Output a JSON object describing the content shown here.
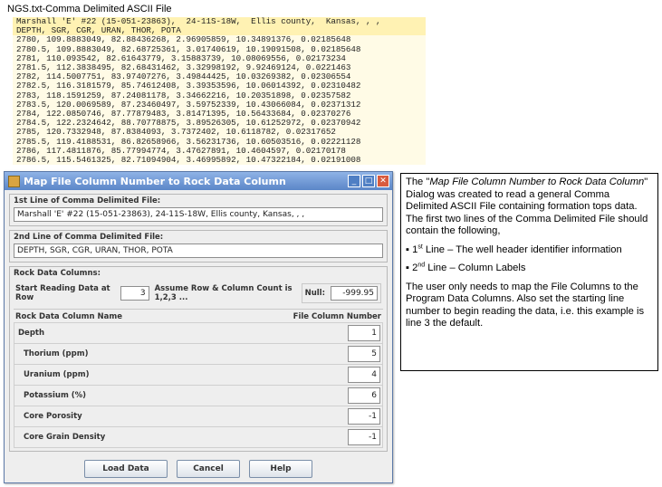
{
  "file": {
    "title": "NGS.txt-Comma Delimited ASCII File",
    "lines": [
      "Marshall 'E' #22 (15-051-23863),  24-11S-18W,  Ellis county,  Kansas, , ,",
      "DEPTH, SGR, CGR, URAN, THOR, POTA",
      "2780, 109.8883049, 82.88436268, 2.96905859, 10.34891376, 0.02185648",
      "2780.5, 109.8883049, 82.68725361, 3.01740619, 10.19091508, 0.02185648",
      "2781, 110.093542, 82.61643779, 3.15883739, 10.08069556, 0.02173234",
      "2781.5, 112.3838495, 82.68431462, 3.32998192, 9.92469124, 0.0221463",
      "2782, 114.5007751, 83.97407276, 3.49844425, 10.03269382, 0.02306554",
      "2782.5, 116.3181579, 85.74612408, 3.39353596, 10.06014392, 0.02310482",
      "2783, 118.1591259, 87.24081178, 3.34662216, 10.20351898, 0.02357582",
      "2783.5, 120.0069589, 87.23460497, 3.59752339, 10.43066084, 0.02371312",
      "2784, 122.0850746, 87.77879483, 3.81471395, 10.56433684, 0.02370276",
      "2784.5, 122.2324642, 88.70778875, 3.89526305, 10.61252972, 0.02370942",
      "2785, 120.7332948, 87.8384093, 3.7372402, 10.6118782, 0.02317652",
      "2785.5, 119.4188531, 86.82658966, 3.56231736, 10.60503516, 0.02221128",
      "2786, 117.4811876, 85.77994774, 3.47627891, 10.4604597, 0.02170178",
      "2786.5, 115.5461325, 82.71094904, 3.46995892, 10.47322184, 0.02191008"
    ]
  },
  "dialog": {
    "title": "Map File Column Number to Rock Data Column",
    "line1_label": "1st Line of Comma Delimited File:",
    "line1_value": "Marshall 'E' #22 (15-051-23863),  24-11S-18W,  Ellis county,  Kansas, , ,",
    "line2_label": "2nd Line of Comma Delimited File:",
    "line2_value": "DEPTH, SGR, CGR, URAN, THOR, POTA",
    "rock_label": "Rock Data Columns:",
    "start_label": "Start Reading Data at Row",
    "start_value": "3",
    "assume_label": "Assume Row & Column Count is 1,2,3 ...",
    "null_label": "Null:",
    "null_value": "-999.95",
    "col_name_header": "Rock Data Column Name",
    "file_col_header": "File Column Number",
    "rows": [
      {
        "label": "Depth",
        "value": "1"
      },
      {
        "label": "Thorium (ppm)",
        "value": "5"
      },
      {
        "label": "Uranium (ppm)",
        "value": "4"
      },
      {
        "label": "Potassium (%)",
        "value": "6"
      },
      {
        "label": "Core Porosity",
        "value": "-1"
      },
      {
        "label": "Core Grain Density",
        "value": "-1"
      }
    ],
    "buttons": {
      "load": "Load Data",
      "cancel": "Cancel",
      "help": "Help"
    },
    "window_controls": {
      "minimize": "_",
      "maximize": "□",
      "close": "✕"
    }
  },
  "description": {
    "p1_a": "The \"",
    "p1_italic": "Map File Column Number to Rock Data Column",
    "p1_b": "\" Dialog was created to read a general Comma Delimited ASCII File containing formation tops data. The first two lines of the Comma Delimited File should contain the following,",
    "b1_num": "1",
    "b1_sup": "st",
    "b1_text": " Line – The well header identifier information",
    "b2_num": "2",
    "b2_sup": "nd",
    "b2_text": " Line – Column Labels",
    "p2": "The user only needs to map the File Columns to the Program Data Columns.  Also set the starting line number to begin reading the data, i.e. this example is line 3 the default."
  },
  "colors": {
    "titlebar": "#5b86c8",
    "close": "#d85b3e",
    "file_bg": "#fffbe6"
  }
}
